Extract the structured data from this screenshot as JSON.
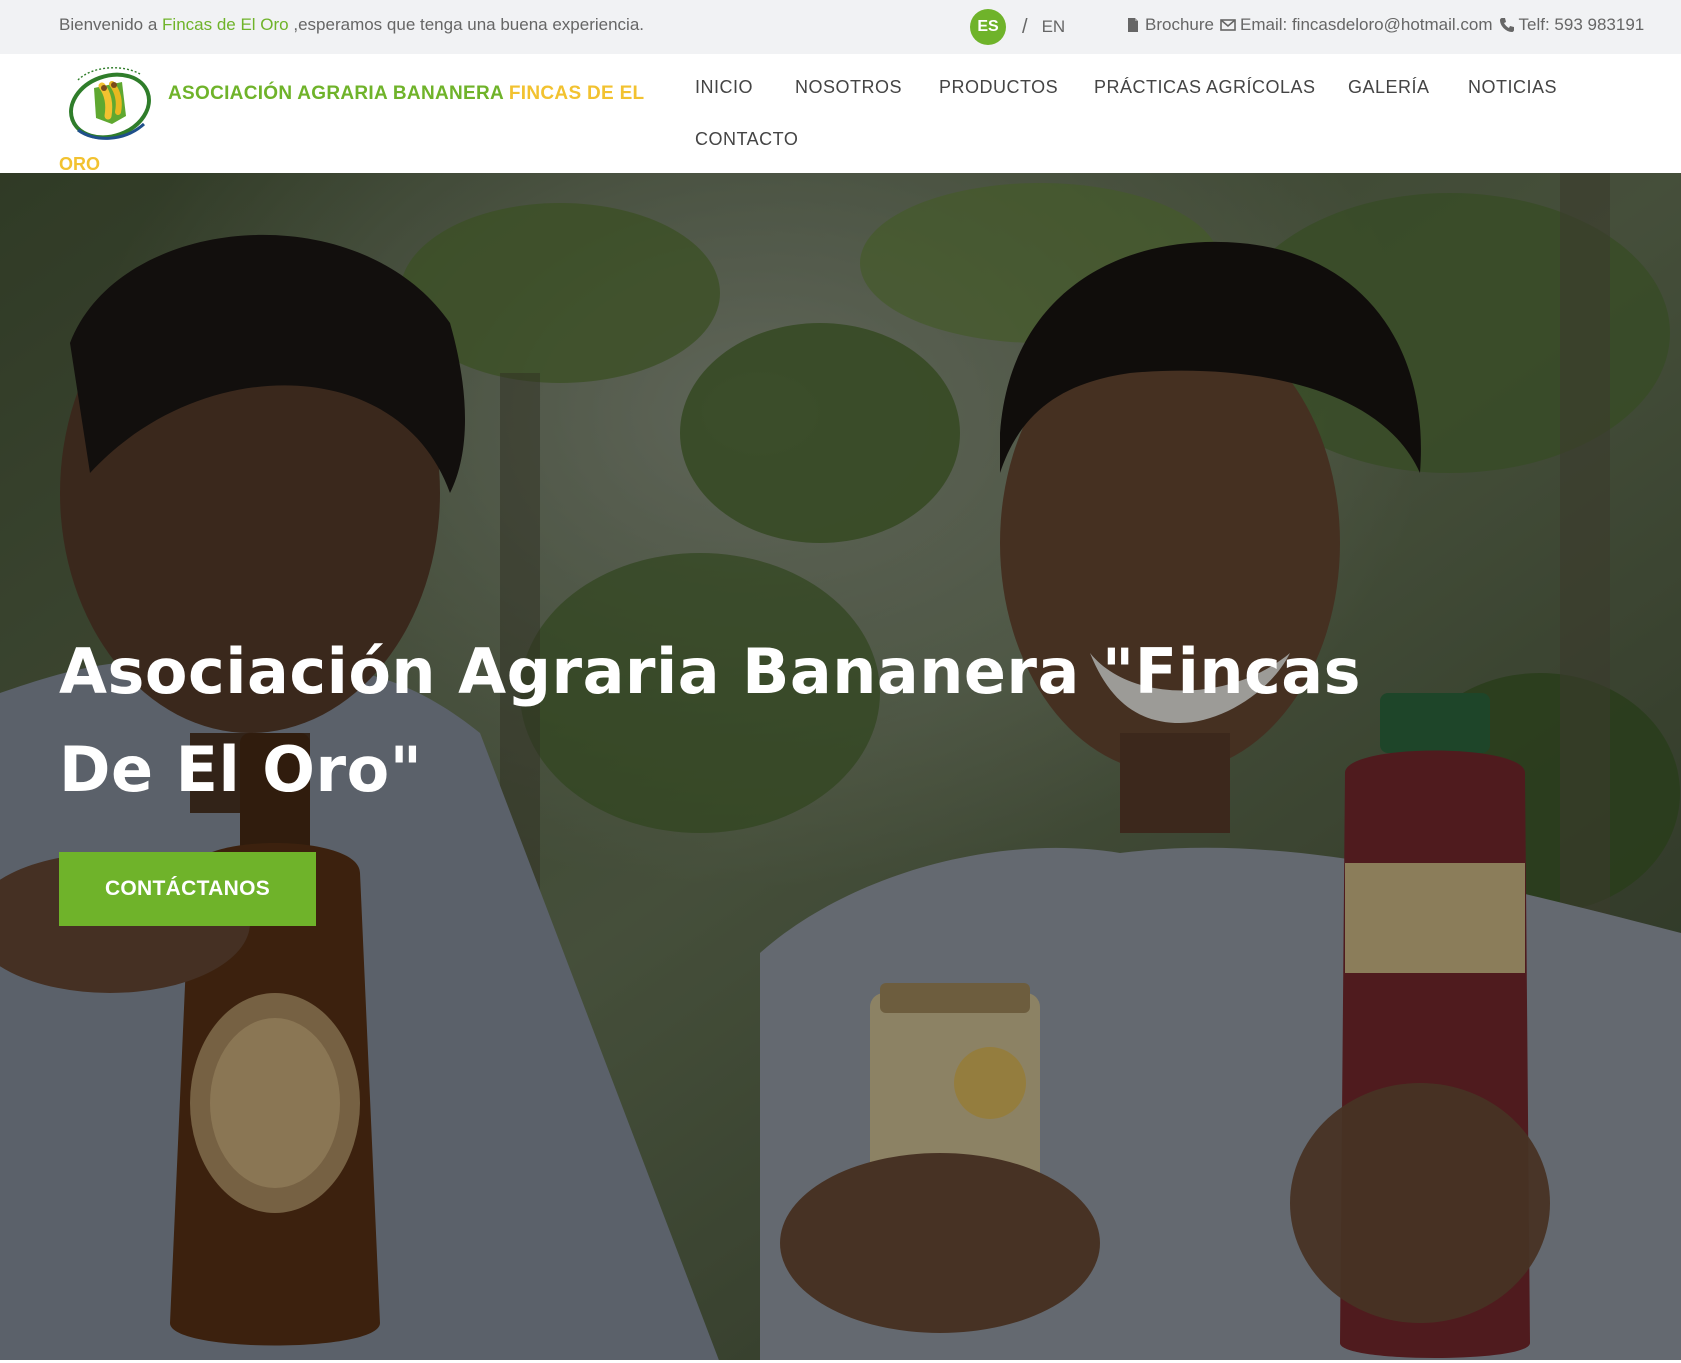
{
  "topbar": {
    "welcome_prefix": "Bienvenido a ",
    "welcome_highlight": "Fincas de El Oro",
    "welcome_suffix": " ,esperamos que tenga una buena experiencia.",
    "lang_es": "ES",
    "lang_separator": "/",
    "lang_en": "EN",
    "brochure_label": "Brochure",
    "email_label": "Email: fincasdeloro@hotmail.com",
    "phone_label": "Telf: 593 983191"
  },
  "header": {
    "brand_green": "ASOCIACIÓN AGRARIA BANANERA ",
    "brand_yellow": "FINCAS DE EL",
    "brand_line2": "ORO",
    "nav": [
      "INICIO",
      "NOSOTROS",
      "PRODUCTOS",
      "PRÁCTICAS AGRÍCOLAS",
      "GALERÍA",
      "NOTICIAS",
      "CONTACTO"
    ]
  },
  "hero": {
    "title_line1": "Asociación Agraria Bananera \"Fincas",
    "title_line2": "De El Oro\"",
    "button_label": "CONTÁCTANOS"
  },
  "colors": {
    "accent_green": "#6fb32a",
    "accent_yellow": "#f2c230",
    "topbar_bg": "#f1f2f4"
  },
  "icons": {
    "brochure": "file-icon",
    "email": "envelope-icon",
    "phone": "phone-icon"
  }
}
